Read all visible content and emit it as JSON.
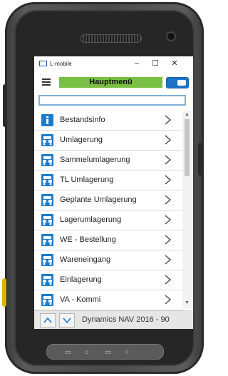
{
  "window": {
    "title": "L-mobile",
    "minimize": "–",
    "maximize": "☐",
    "close": "✕"
  },
  "header": {
    "title": "Hauptmenü"
  },
  "search": {
    "placeholder": ""
  },
  "menu": {
    "items": [
      {
        "label": "Bestandsinfo",
        "icon": "info-icon"
      },
      {
        "label": "Umlagerung",
        "icon": "forklift-icon"
      },
      {
        "label": "Sammelumlagerung",
        "icon": "forklift-icon"
      },
      {
        "label": "TL Umlagerung",
        "icon": "forklift-icon"
      },
      {
        "label": "Geplante Umlagerung",
        "icon": "forklift-icon"
      },
      {
        "label": "Lagerumlagerung",
        "icon": "forklift-icon"
      },
      {
        "label": "WE - Bestellung",
        "icon": "forklift-icon"
      },
      {
        "label": "Wareneingang",
        "icon": "forklift-icon"
      },
      {
        "label": "Einlagerung",
        "icon": "forklift-icon"
      },
      {
        "label": "VA - Kommi",
        "icon": "forklift-icon"
      }
    ]
  },
  "footer": {
    "status": "Dynamics NAV 2016 - 90"
  },
  "colors": {
    "accent_green": "#77c043",
    "accent_blue": "#1e7bcc"
  }
}
